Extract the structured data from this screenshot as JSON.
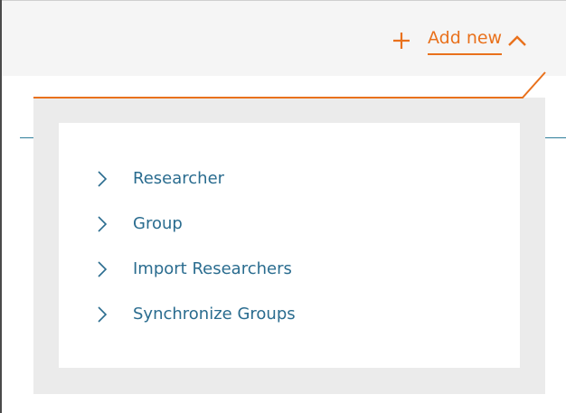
{
  "header": {
    "add_new_label": "Add new",
    "plus_icon": "plus-icon",
    "caret_icon": "caret-up-icon"
  },
  "dropdown": {
    "items": [
      {
        "label": "Researcher",
        "icon": "chevron-right-icon"
      },
      {
        "label": "Group",
        "icon": "chevron-right-icon"
      },
      {
        "label": "Import Researchers",
        "icon": "chevron-right-icon"
      },
      {
        "label": "Synchronize Groups",
        "icon": "chevron-right-icon"
      }
    ]
  },
  "colors": {
    "accent": "#e9711c",
    "link": "#2a6c8f",
    "header_bg": "#f5f5f5",
    "dropdown_bg": "#ebebeb"
  }
}
